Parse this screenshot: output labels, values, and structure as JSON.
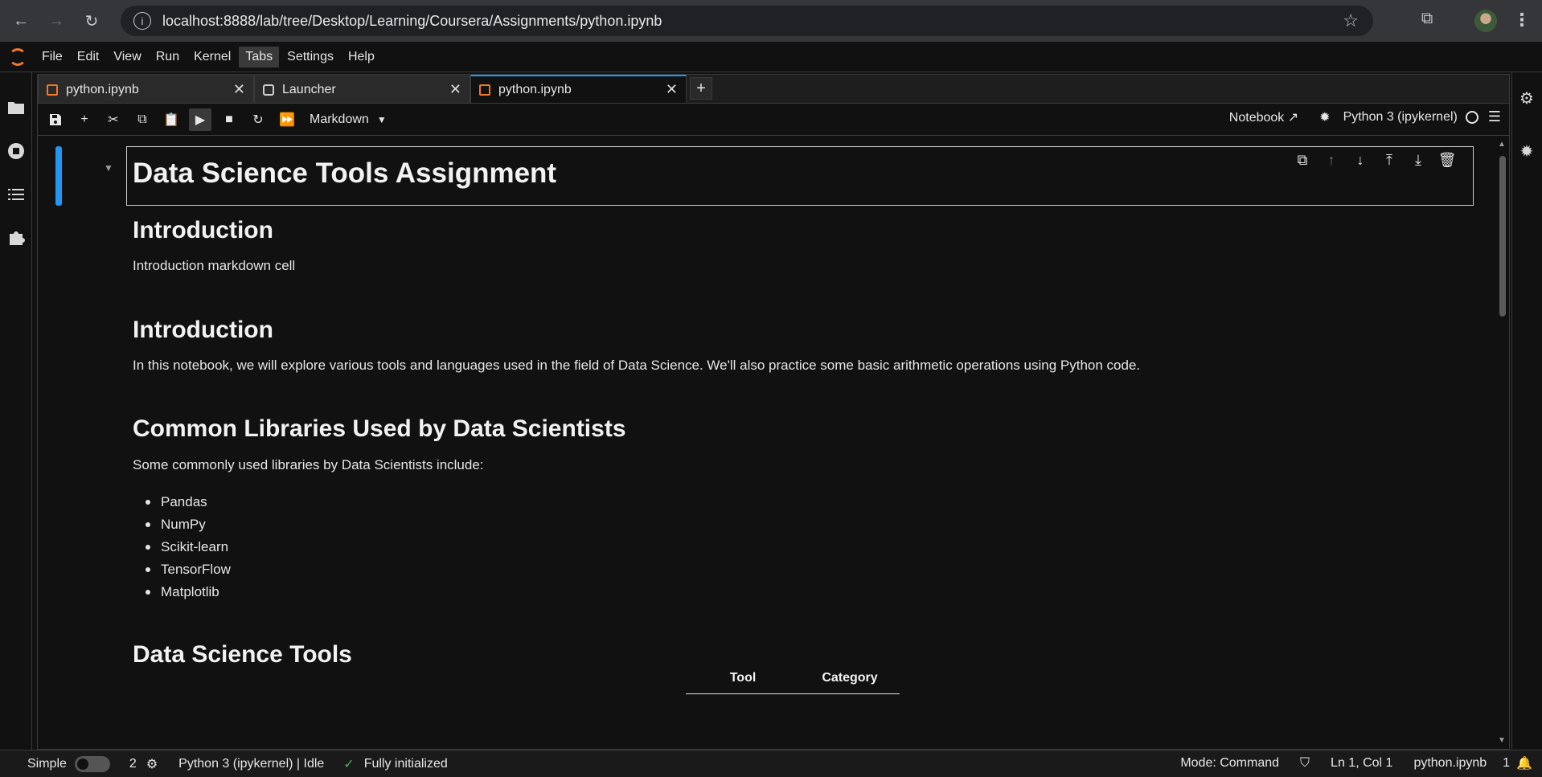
{
  "browser": {
    "url": "localhost:8888/lab/tree/Desktop/Learning/Coursera/Assignments/python.ipynb"
  },
  "menubar": {
    "items": [
      "File",
      "Edit",
      "View",
      "Run",
      "Kernel",
      "Tabs",
      "Settings",
      "Help"
    ],
    "active": "Tabs"
  },
  "tabs": [
    {
      "label": "python.ipynb",
      "icon": "notebook-icon"
    },
    {
      "label": "Launcher",
      "icon": "launcher-icon"
    },
    {
      "label": "python.ipynb",
      "icon": "notebook-icon",
      "active": true
    }
  ],
  "toolbar": {
    "cell_type": "Markdown",
    "notebook_label": "Notebook",
    "kernel_name": "Python 3 (ipykernel)"
  },
  "notebook": {
    "title": "Data Science Tools Assignment",
    "intro_heading_1": "Introduction",
    "intro_text_1": "Introduction markdown cell",
    "intro_heading_2": "Introduction",
    "intro_text_2": "In this notebook, we will explore various tools and languages used in the field of Data Science. We'll also practice some basic arithmetic operations using Python code.",
    "libraries_heading": "Common Libraries Used by Data Scientists",
    "libraries_text": "Some commonly used libraries by Data Scientists include:",
    "libraries": [
      "Pandas",
      "NumPy",
      "Scikit-learn",
      "TensorFlow",
      "Matplotlib"
    ],
    "tools_heading": "Data Science Tools",
    "table_headers": [
      "Tool",
      "Category"
    ]
  },
  "statusbar": {
    "mode_label": "Simple",
    "kernel_count": "2",
    "kernel_status": "Python 3 (ipykernel) | Idle",
    "init_status": "Fully initialized",
    "mode": "Mode: Command",
    "cursor": "Ln 1, Col 1",
    "filename": "python.ipynb",
    "notifications": "1"
  }
}
